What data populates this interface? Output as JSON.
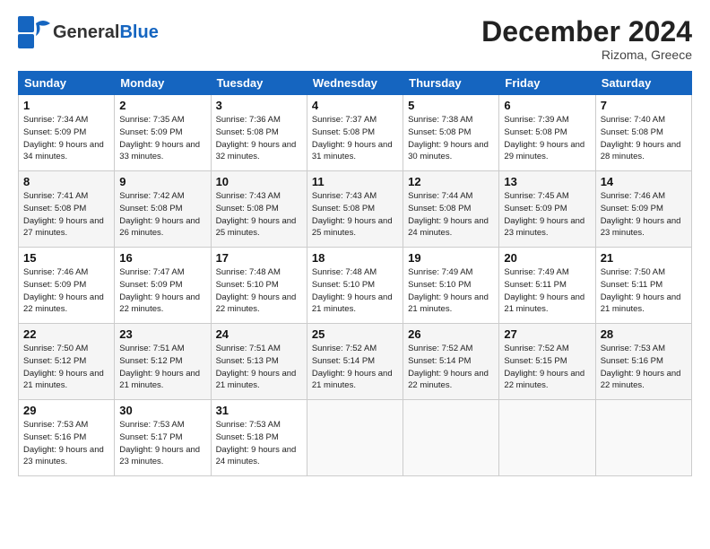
{
  "header": {
    "logo_general": "General",
    "logo_blue": "Blue",
    "month": "December 2024",
    "location": "Rizoma, Greece"
  },
  "weekdays": [
    "Sunday",
    "Monday",
    "Tuesday",
    "Wednesday",
    "Thursday",
    "Friday",
    "Saturday"
  ],
  "weeks": [
    [
      {
        "day": "1",
        "sunrise": "Sunrise: 7:34 AM",
        "sunset": "Sunset: 5:09 PM",
        "daylight": "Daylight: 9 hours and 34 minutes."
      },
      {
        "day": "2",
        "sunrise": "Sunrise: 7:35 AM",
        "sunset": "Sunset: 5:09 PM",
        "daylight": "Daylight: 9 hours and 33 minutes."
      },
      {
        "day": "3",
        "sunrise": "Sunrise: 7:36 AM",
        "sunset": "Sunset: 5:08 PM",
        "daylight": "Daylight: 9 hours and 32 minutes."
      },
      {
        "day": "4",
        "sunrise": "Sunrise: 7:37 AM",
        "sunset": "Sunset: 5:08 PM",
        "daylight": "Daylight: 9 hours and 31 minutes."
      },
      {
        "day": "5",
        "sunrise": "Sunrise: 7:38 AM",
        "sunset": "Sunset: 5:08 PM",
        "daylight": "Daylight: 9 hours and 30 minutes."
      },
      {
        "day": "6",
        "sunrise": "Sunrise: 7:39 AM",
        "sunset": "Sunset: 5:08 PM",
        "daylight": "Daylight: 9 hours and 29 minutes."
      },
      {
        "day": "7",
        "sunrise": "Sunrise: 7:40 AM",
        "sunset": "Sunset: 5:08 PM",
        "daylight": "Daylight: 9 hours and 28 minutes."
      }
    ],
    [
      {
        "day": "8",
        "sunrise": "Sunrise: 7:41 AM",
        "sunset": "Sunset: 5:08 PM",
        "daylight": "Daylight: 9 hours and 27 minutes."
      },
      {
        "day": "9",
        "sunrise": "Sunrise: 7:42 AM",
        "sunset": "Sunset: 5:08 PM",
        "daylight": "Daylight: 9 hours and 26 minutes."
      },
      {
        "day": "10",
        "sunrise": "Sunrise: 7:43 AM",
        "sunset": "Sunset: 5:08 PM",
        "daylight": "Daylight: 9 hours and 25 minutes."
      },
      {
        "day": "11",
        "sunrise": "Sunrise: 7:43 AM",
        "sunset": "Sunset: 5:08 PM",
        "daylight": "Daylight: 9 hours and 25 minutes."
      },
      {
        "day": "12",
        "sunrise": "Sunrise: 7:44 AM",
        "sunset": "Sunset: 5:08 PM",
        "daylight": "Daylight: 9 hours and 24 minutes."
      },
      {
        "day": "13",
        "sunrise": "Sunrise: 7:45 AM",
        "sunset": "Sunset: 5:09 PM",
        "daylight": "Daylight: 9 hours and 23 minutes."
      },
      {
        "day": "14",
        "sunrise": "Sunrise: 7:46 AM",
        "sunset": "Sunset: 5:09 PM",
        "daylight": "Daylight: 9 hours and 23 minutes."
      }
    ],
    [
      {
        "day": "15",
        "sunrise": "Sunrise: 7:46 AM",
        "sunset": "Sunset: 5:09 PM",
        "daylight": "Daylight: 9 hours and 22 minutes."
      },
      {
        "day": "16",
        "sunrise": "Sunrise: 7:47 AM",
        "sunset": "Sunset: 5:09 PM",
        "daylight": "Daylight: 9 hours and 22 minutes."
      },
      {
        "day": "17",
        "sunrise": "Sunrise: 7:48 AM",
        "sunset": "Sunset: 5:10 PM",
        "daylight": "Daylight: 9 hours and 22 minutes."
      },
      {
        "day": "18",
        "sunrise": "Sunrise: 7:48 AM",
        "sunset": "Sunset: 5:10 PM",
        "daylight": "Daylight: 9 hours and 21 minutes."
      },
      {
        "day": "19",
        "sunrise": "Sunrise: 7:49 AM",
        "sunset": "Sunset: 5:10 PM",
        "daylight": "Daylight: 9 hours and 21 minutes."
      },
      {
        "day": "20",
        "sunrise": "Sunrise: 7:49 AM",
        "sunset": "Sunset: 5:11 PM",
        "daylight": "Daylight: 9 hours and 21 minutes."
      },
      {
        "day": "21",
        "sunrise": "Sunrise: 7:50 AM",
        "sunset": "Sunset: 5:11 PM",
        "daylight": "Daylight: 9 hours and 21 minutes."
      }
    ],
    [
      {
        "day": "22",
        "sunrise": "Sunrise: 7:50 AM",
        "sunset": "Sunset: 5:12 PM",
        "daylight": "Daylight: 9 hours and 21 minutes."
      },
      {
        "day": "23",
        "sunrise": "Sunrise: 7:51 AM",
        "sunset": "Sunset: 5:12 PM",
        "daylight": "Daylight: 9 hours and 21 minutes."
      },
      {
        "day": "24",
        "sunrise": "Sunrise: 7:51 AM",
        "sunset": "Sunset: 5:13 PM",
        "daylight": "Daylight: 9 hours and 21 minutes."
      },
      {
        "day": "25",
        "sunrise": "Sunrise: 7:52 AM",
        "sunset": "Sunset: 5:14 PM",
        "daylight": "Daylight: 9 hours and 21 minutes."
      },
      {
        "day": "26",
        "sunrise": "Sunrise: 7:52 AM",
        "sunset": "Sunset: 5:14 PM",
        "daylight": "Daylight: 9 hours and 22 minutes."
      },
      {
        "day": "27",
        "sunrise": "Sunrise: 7:52 AM",
        "sunset": "Sunset: 5:15 PM",
        "daylight": "Daylight: 9 hours and 22 minutes."
      },
      {
        "day": "28",
        "sunrise": "Sunrise: 7:53 AM",
        "sunset": "Sunset: 5:16 PM",
        "daylight": "Daylight: 9 hours and 22 minutes."
      }
    ],
    [
      {
        "day": "29",
        "sunrise": "Sunrise: 7:53 AM",
        "sunset": "Sunset: 5:16 PM",
        "daylight": "Daylight: 9 hours and 23 minutes."
      },
      {
        "day": "30",
        "sunrise": "Sunrise: 7:53 AM",
        "sunset": "Sunset: 5:17 PM",
        "daylight": "Daylight: 9 hours and 23 minutes."
      },
      {
        "day": "31",
        "sunrise": "Sunrise: 7:53 AM",
        "sunset": "Sunset: 5:18 PM",
        "daylight": "Daylight: 9 hours and 24 minutes."
      },
      null,
      null,
      null,
      null
    ]
  ]
}
